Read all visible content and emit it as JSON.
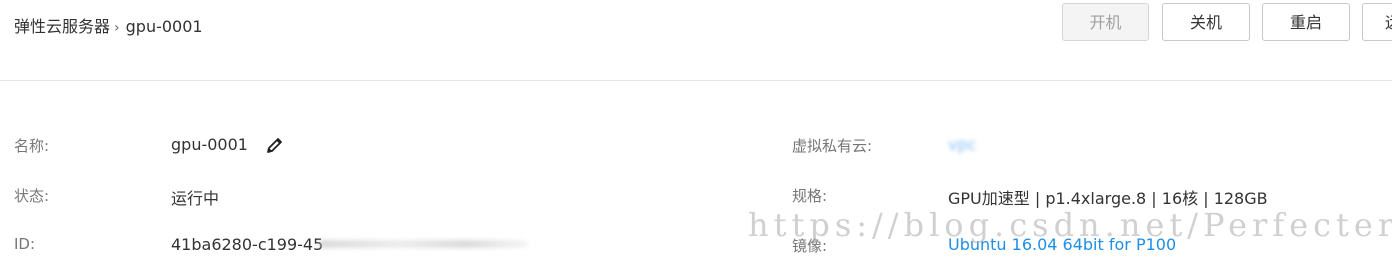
{
  "breadcrumb": {
    "parent": "弹性云服务器",
    "separator": "›",
    "current": "gpu-0001"
  },
  "toolbar": {
    "start_label": "开机",
    "stop_label": "关机",
    "restart_label": "重启",
    "more_label": "远"
  },
  "details": {
    "name_label": "名称:",
    "name_value": "gpu-0001",
    "status_label": "状态:",
    "status_value": "运行中",
    "id_label": "ID:",
    "id_value": "41ba6280-c199-45",
    "vpc_label": "虚拟私有云:",
    "vpc_value": "vpc",
    "spec_label": "规格:",
    "spec_value": "GPU加速型 | p1.4xlarge.8 | 16核 | 128GB",
    "image_label": "镜像:",
    "image_value": "Ubuntu 16.04 64bit for P100"
  },
  "watermark": "https://blog.csdn.net/Perfecter",
  "icons": {
    "edit": "pencil-icon"
  },
  "colors": {
    "link": "#1e8ee6",
    "disabled_bg": "#f4f4f4"
  }
}
